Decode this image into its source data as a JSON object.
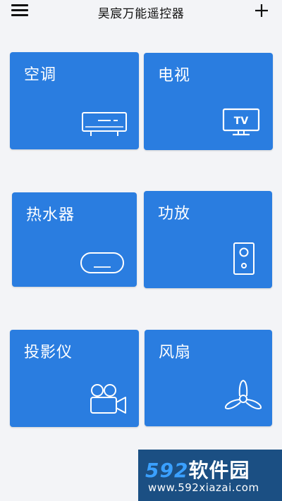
{
  "header": {
    "title": "昊宸万能遥控器",
    "menu_icon": "hamburger-menu-icon",
    "add_icon": "plus-icon"
  },
  "devices": [
    {
      "label": "空调",
      "icon": "air-conditioner-icon"
    },
    {
      "label": "电视",
      "icon": "tv-icon",
      "icon_text": "TV"
    },
    {
      "label": "热水器",
      "icon": "water-heater-icon"
    },
    {
      "label": "功放",
      "icon": "speaker-icon"
    },
    {
      "label": "投影仪",
      "icon": "projector-camera-icon"
    },
    {
      "label": "风扇",
      "icon": "fan-icon"
    }
  ],
  "watermark": {
    "brand_num": "592",
    "brand_text": "软件园",
    "url": "www.592xiazai.com"
  },
  "colors": {
    "card": "#2a7de0",
    "background": "#f3f4f7",
    "watermark_bg": "#1b4f83"
  }
}
